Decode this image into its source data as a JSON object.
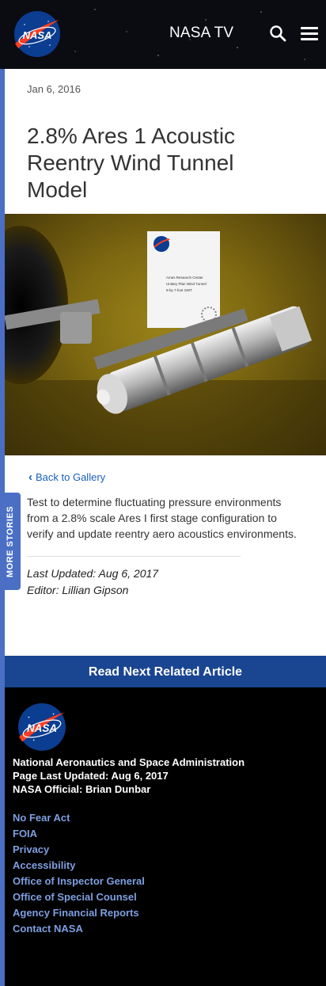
{
  "header": {
    "brand": "NASA",
    "tv_label": "NASA TV"
  },
  "article": {
    "date": "Jan 6, 2016",
    "title": "2.8% Ares 1 Acoustic Reentry Wind Tunnel Model",
    "image_sign_lines": [
      "Ames Research Center",
      "Unitary Plan Wind Tunnel",
      "9-by 7-foot SWT"
    ],
    "back_label": "Back to Gallery",
    "description": "Test to determine fluctuating pressure environments from a 2.8% scale Ares I first stage configuration to verify and update reentry aero acoustics environments.",
    "last_updated": "Last Updated: Aug 6, 2017",
    "editor": "Editor: Lillian Gipson"
  },
  "side_tab": {
    "label": "MORE STORIES"
  },
  "read_next": {
    "label": "Read Next Related Article"
  },
  "footer": {
    "brand": "NASA",
    "agency": "National Aeronautics and Space Administration",
    "page_updated": "Page Last Updated: Aug 6, 2017",
    "official": "NASA Official: Brian Dunbar",
    "links": [
      "No Fear Act",
      "FOIA",
      "Privacy",
      "Accessibility",
      "Office of Inspector General",
      "Office of Special Counsel",
      "Agency Financial Reports",
      "Contact NASA"
    ]
  },
  "colors": {
    "accent": "#4a6fc4",
    "link": "#1a5fbf",
    "banner": "#1a4590",
    "footer_link": "#7e9fe0"
  }
}
